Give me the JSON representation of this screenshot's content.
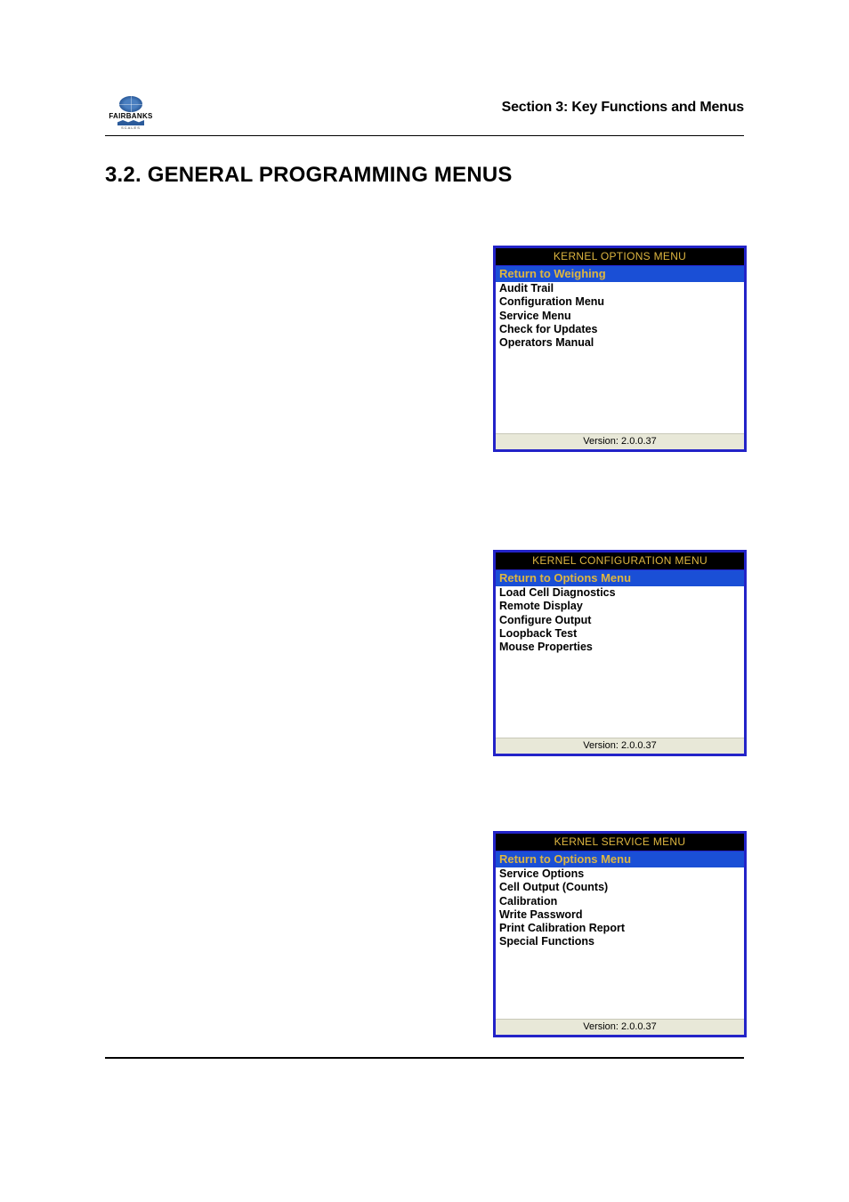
{
  "header": {
    "brand": "FAIRBANKS",
    "brand_sub": "SCALES",
    "section_label": "Section 3: Key Functions and Menus"
  },
  "heading": "3.2.  GENERAL PROGRAMMING MENUS",
  "menus": {
    "options": {
      "title": "KERNEL OPTIONS MENU",
      "selected": "Return to Weighing",
      "items": [
        "Audit Trail",
        "Configuration Menu",
        "Service Menu",
        "Check for Updates",
        "Operators Manual"
      ],
      "version": "Version: 2.0.0.37"
    },
    "config": {
      "title": "KERNEL CONFIGURATION MENU",
      "selected": "Return to Options Menu",
      "items": [
        "Load Cell Diagnostics",
        "Remote Display",
        "Configure Output",
        "Loopback Test",
        "Mouse Properties"
      ],
      "version": "Version: 2.0.0.37"
    },
    "service": {
      "title": "KERNEL SERVICE MENU",
      "selected": "Return to Options Menu",
      "items": [
        "Service Options",
        "Cell Output (Counts)",
        "Calibration",
        "Write Password",
        "Print Calibration Report",
        "Special Functions"
      ],
      "version": "Version: 2.0.0.37"
    }
  }
}
